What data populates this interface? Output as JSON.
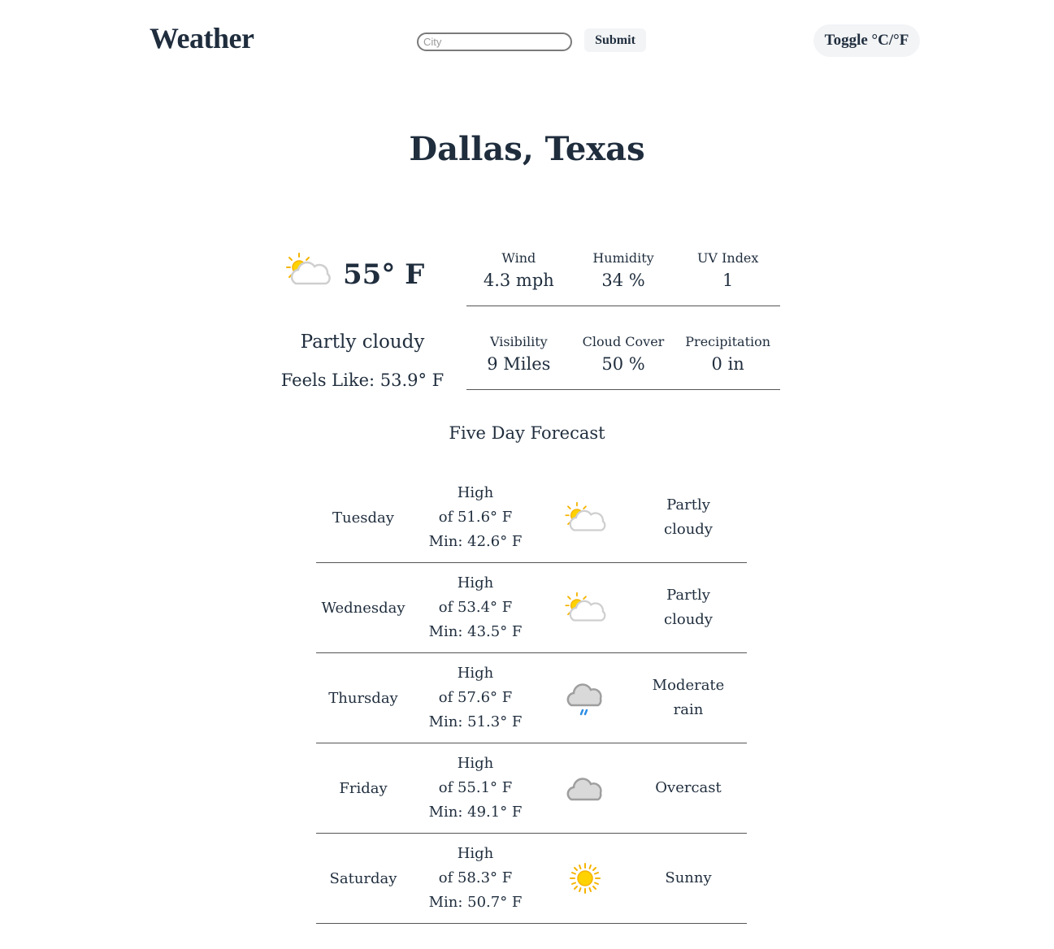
{
  "header": {
    "logo": "Weather",
    "search_placeholder": "City",
    "submit_label": "Submit",
    "toggle_label": "Toggle °C/°F"
  },
  "location": {
    "name": "Dallas, Texas"
  },
  "current": {
    "icon": "partly-cloudy-icon",
    "temperature": "55° F",
    "condition": "Partly cloudy",
    "feels_like": "Feels Like: 53.9° F",
    "stats": [
      {
        "label": "Wind",
        "value": "4.3 mph"
      },
      {
        "label": "Humidity",
        "value": "34 %"
      },
      {
        "label": "UV Index",
        "value": "1"
      },
      {
        "label": "Visibility",
        "value": "9 Miles"
      },
      {
        "label": "Cloud Cover",
        "value": "50 %"
      },
      {
        "label": "Precipitation",
        "value": "0 in"
      }
    ]
  },
  "forecast": {
    "title": "Five Day Forecast",
    "days": [
      {
        "day": "Tuesday",
        "high_line1": "High",
        "high_line2": "of 51.6° F",
        "min": "Min: 42.6° F",
        "icon": "partly-cloudy-icon",
        "desc_line1": "Partly",
        "desc_line2": "cloudy"
      },
      {
        "day": "Wednesday",
        "high_line1": "High",
        "high_line2": "of 53.4° F",
        "min": "Min: 43.5° F",
        "icon": "partly-cloudy-icon",
        "desc_line1": "Partly",
        "desc_line2": "cloudy"
      },
      {
        "day": "Thursday",
        "high_line1": "High",
        "high_line2": "of 57.6° F",
        "min": "Min: 51.3° F",
        "icon": "rain-cloud-icon",
        "desc_line1": "Moderate",
        "desc_line2": "rain"
      },
      {
        "day": "Friday",
        "high_line1": "High",
        "high_line2": "of 55.1° F",
        "min": "Min: 49.1° F",
        "icon": "overcast-cloud-icon",
        "desc_line1": "Overcast",
        "desc_line2": ""
      },
      {
        "day": "Saturday",
        "high_line1": "High",
        "high_line2": "of 58.3° F",
        "min": "Min: 50.7° F",
        "icon": "sun-icon",
        "desc_line1": "Sunny",
        "desc_line2": ""
      }
    ]
  },
  "colors": {
    "text": "#1f2d3d",
    "sun": "#f5b400",
    "cloud_light": "#d9d9d9",
    "cloud_dark": "#9e9e9e",
    "rain": "#2f8de4",
    "divider": "#555555"
  }
}
